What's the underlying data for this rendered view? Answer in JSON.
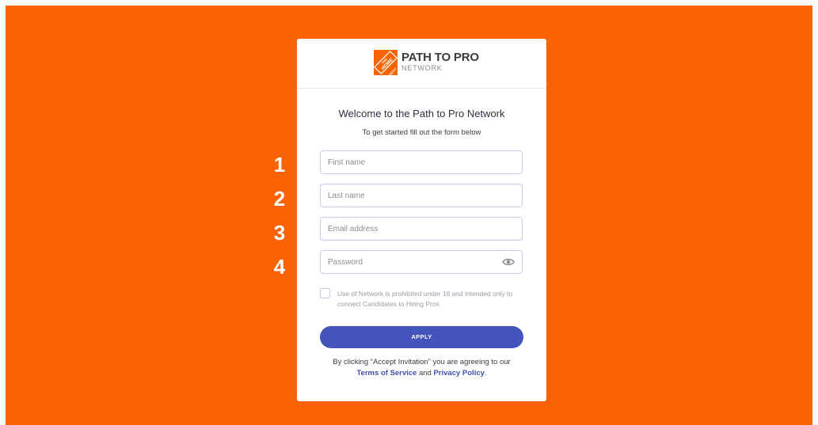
{
  "step_numbers": [
    "1",
    "2",
    "3",
    "4"
  ],
  "logo": {
    "title": "PATH TO PRO",
    "subtitle": "NETWORK",
    "mark_text": "THE HOME DEPOT"
  },
  "welcome_title": "Welcome to the Path to Pro Network",
  "subtitle": "To get started fill out the form below",
  "form": {
    "first_name_placeholder": "First name",
    "last_name_placeholder": "Last name",
    "email_placeholder": "Email address",
    "password_placeholder": "Password",
    "consent_text": "Use of Network is prohibited under 18 and intended only to connect Candidates to Hiring Pros",
    "consent_checked": false,
    "apply_label": "APPLY"
  },
  "legal": {
    "prefix": "By clicking “Accept Invitation” you are agreeing to our",
    "terms_link": "Terms of Service",
    "joiner": "and",
    "privacy_link": "Privacy Policy",
    "suffix": "."
  },
  "colors": {
    "background": "#fb6204",
    "accent": "#4553bc",
    "field_border": "#c7c9ea"
  },
  "icons": {
    "password_toggle": "eye-icon"
  }
}
